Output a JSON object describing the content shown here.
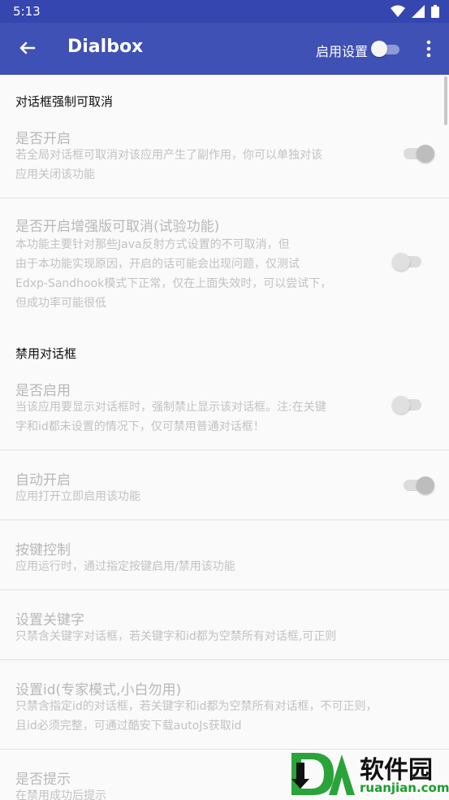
{
  "status_bar": {
    "time": "5:13",
    "icons": [
      "wifi-icon",
      "signal-icon",
      "battery-icon"
    ]
  },
  "app_bar": {
    "title": "Dialbox",
    "enable_label": "启用设置",
    "enable_switch_on": false
  },
  "sections": {
    "dialog_cancelable": {
      "header": "对话框强制可取消"
    },
    "disable_dialog": {
      "header": "禁用对话框"
    }
  },
  "prefs": {
    "enable": {
      "title": "是否开启",
      "summary1": "若全局对话框可取消对该应用产生了副作用，你可以单独对该",
      "summary2": "应用关闭该功能",
      "on": true
    },
    "enhanced": {
      "title": "是否开启增强版可取消(试验功能)",
      "summary1": "本功能主要针对那些Java反射方式设置的不可取消，但",
      "summary2": "由于本功能实现原因，开启的话可能会出现问题，仅测试",
      "summary3": "Edxp-Sandhook模式下正常，仅在上面失效时，可以尝试下，",
      "summary4": "但成功率可能很低",
      "on": false
    },
    "disable_enable": {
      "title": "是否启用",
      "summary1": "当该应用要显示对话框时，强制禁止显示该对话框。注:在关键",
      "summary2": "字和id都未设置的情况下，仅可禁用普通对话框！",
      "on": false
    },
    "auto_start": {
      "title": "自动开启",
      "summary1": "应用打开立即启用该功能",
      "on": true
    },
    "key_control": {
      "title": "按键控制",
      "summary1": "应用运行时，通过指定按键启用/禁用该功能"
    },
    "set_keyword": {
      "title": "设置关键字",
      "summary1": "只禁含关键字对话框，若关键字和id都为空禁所有对话框,可正则"
    },
    "set_id": {
      "title": "设置id(专家模式,小白勿用)",
      "summary1": "只禁含指定id的对话框，若关键字和id都为空禁所有对话框，不可正则，",
      "summary2": "且id必须完整，可通过酷安下载autoJs获取id"
    },
    "show_tip": {
      "title": "是否提示",
      "summary1": "在禁用成功后提示"
    }
  },
  "watermark": {
    "logo_text": "软件园",
    "url": "ruanjian.com"
  },
  "colors": {
    "app_bar": "#3f51b5",
    "status_bar": "#3646b0",
    "disabled_text": "#b8b8b8"
  }
}
